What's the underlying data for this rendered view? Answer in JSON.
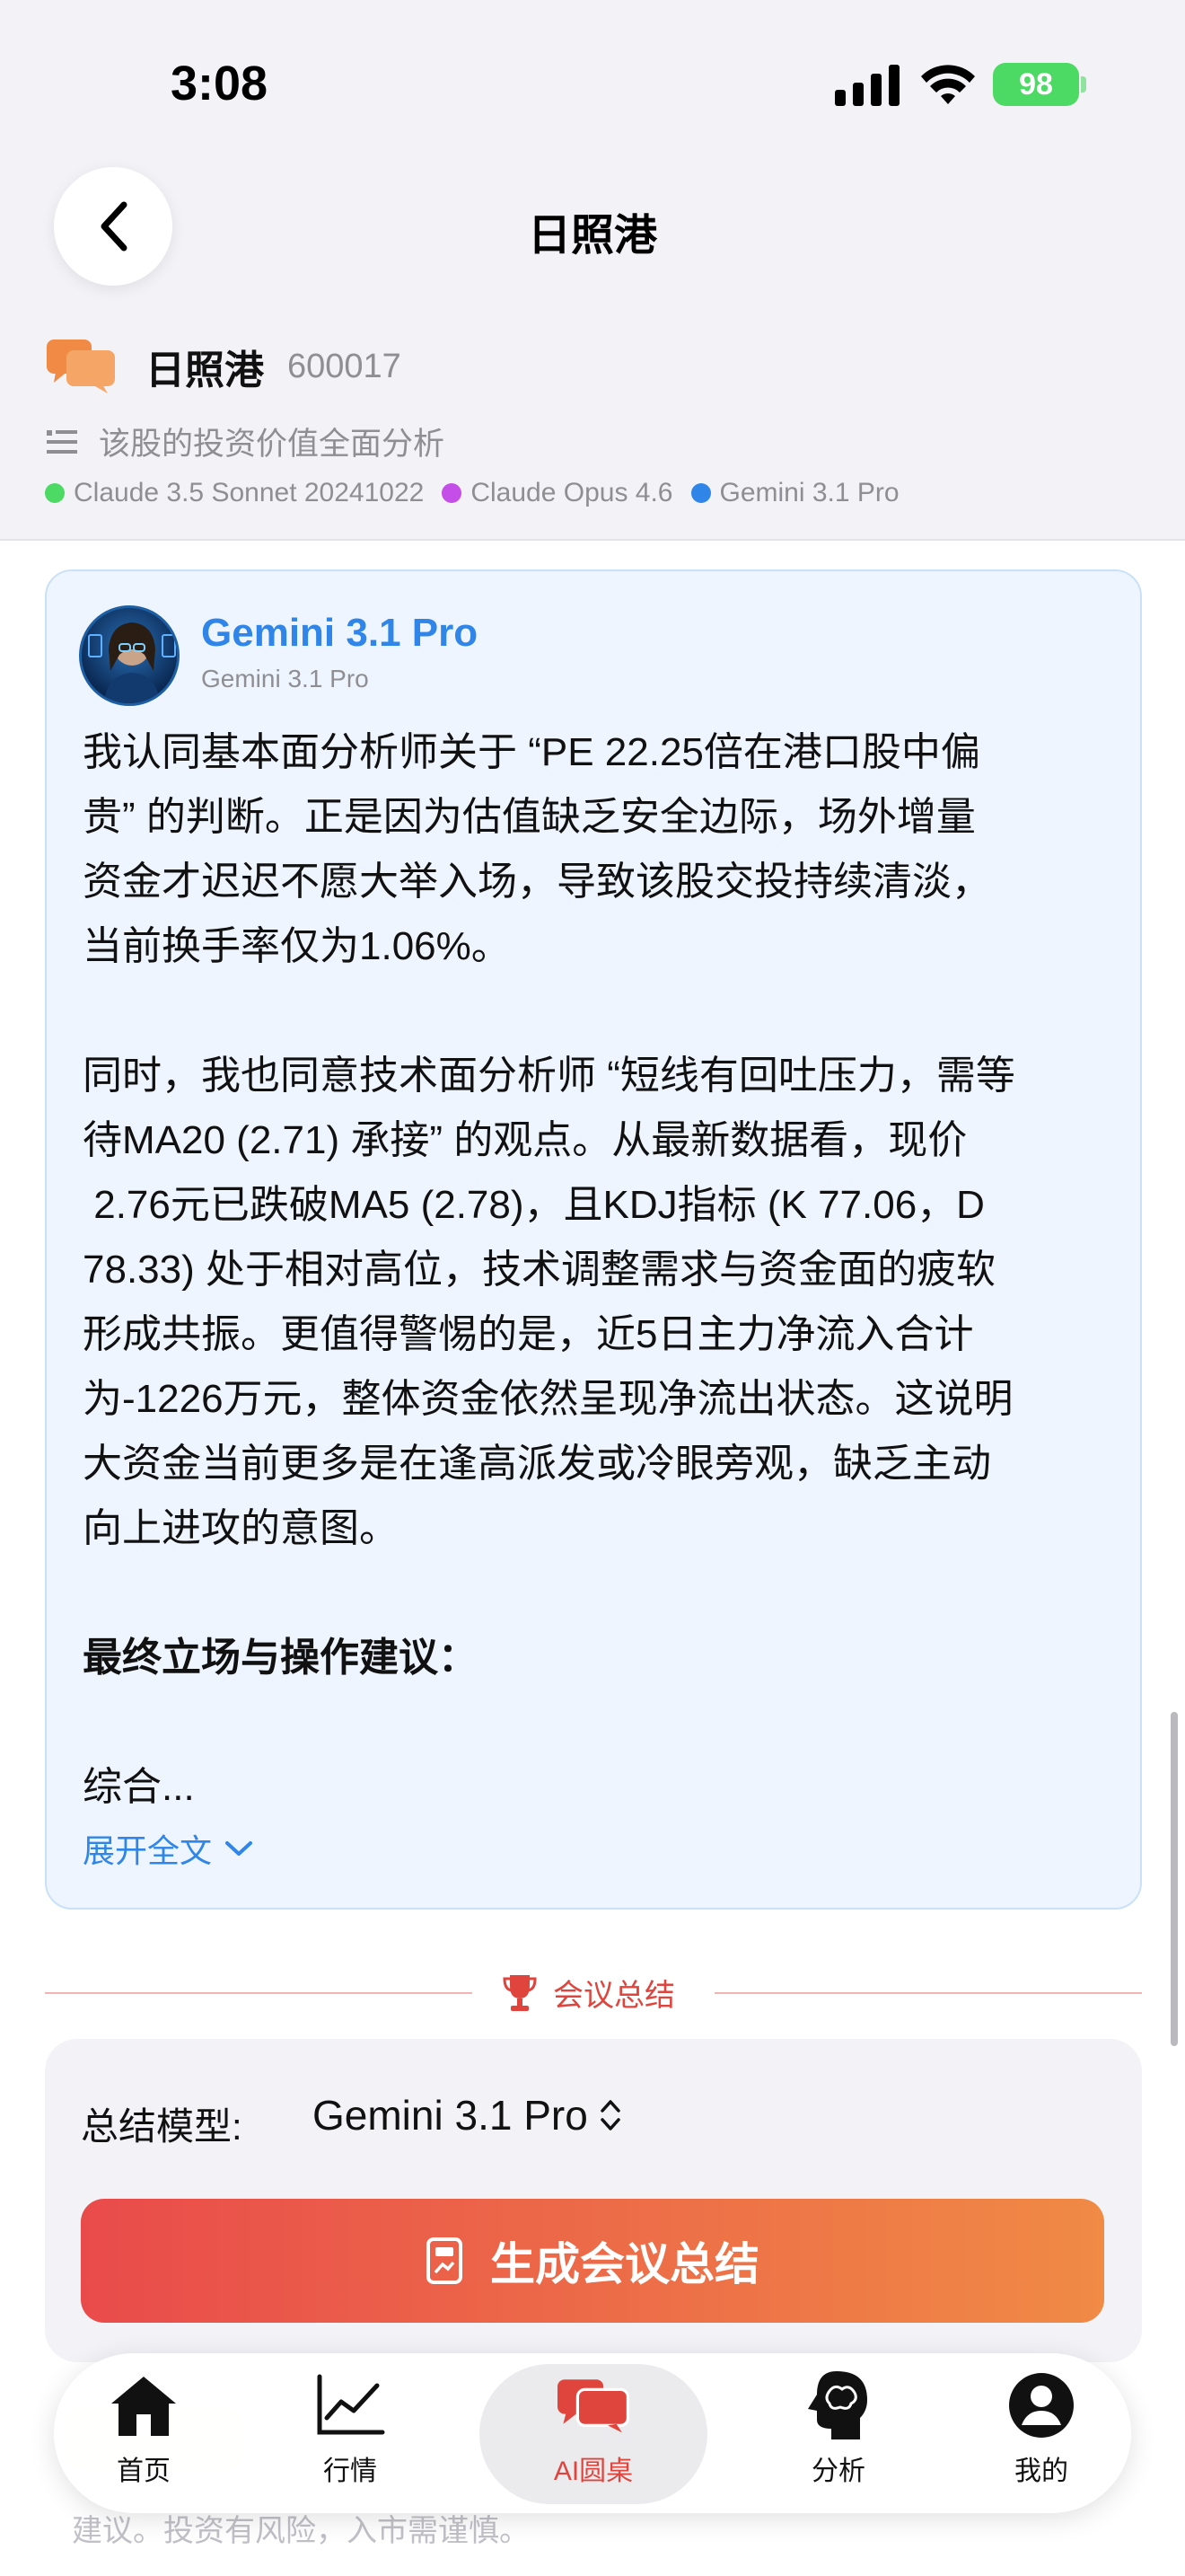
{
  "status_bar": {
    "time": "3:08",
    "battery": "98"
  },
  "nav": {
    "title": "日照港"
  },
  "stock": {
    "name": "日照港",
    "code": "600017",
    "topic": "该股的投资价值全面分析"
  },
  "models": [
    {
      "label": "Claude 3.5 Sonnet 20241022",
      "color": "#4cd964"
    },
    {
      "label": "Claude Opus 4.6",
      "color": "#c54de8"
    },
    {
      "label": "Gemini 3.1 Pro",
      "color": "#2f86e8"
    }
  ],
  "message": {
    "author": "Gemini 3.1 Pro",
    "author_sub": "Gemini 3.1 Pro",
    "para1_lines": [
      "我认同基本面分析师关于 “PE 22.25倍在港口股中偏",
      "贵” 的判断。正是因为估值缺乏安全边际，场外增量",
      "资金才迟迟不愿大举入场，导致该股交投持续清淡，",
      "当前换手率仅为1.06%。"
    ],
    "para2_lines": [
      "同时，我也同意技术面分析师 “短线有回吐压力，需等",
      "待MA20 (2.71) 承接” 的观点。从最新数据看，现价",
      " 2.76元已跌破MA5 (2.78)，且KDJ指标 (K 77.06，D",
      "78.33) 处于相对高位，技术调整需求与资金面的疲软",
      "形成共振。更值得警惕的是，近5日主力净流入合计",
      "为-1226万元，整体资金依然呈现净流出状态。这说明",
      "大资金当前更多是在逢高派发或冷眼旁观，缺乏主动",
      "向上进攻的意图。"
    ],
    "heading": "最终立场与操作建议：",
    "truncated": "综合...",
    "expand_label": "展开全文"
  },
  "divider": {
    "label": "会议总结"
  },
  "summary": {
    "model_label": "总结模型:",
    "model_value": "Gemini 3.1 Pro",
    "generate_label": "生成会议总结"
  },
  "faded_text": "建议。投资有风险，入市需谨慎。",
  "tabs": [
    {
      "label": "首页",
      "icon": "home-icon",
      "active": false
    },
    {
      "label": "行情",
      "icon": "chart-icon",
      "active": false
    },
    {
      "label": "AI圆桌",
      "icon": "chat-bubbles-icon",
      "active": true
    },
    {
      "label": "分析",
      "icon": "brain-head-icon",
      "active": false
    },
    {
      "label": "我的",
      "icon": "user-icon",
      "active": false
    }
  ],
  "colors": {
    "accent_red": "#e0453d",
    "accent_blue": "#2f86e8",
    "button_gradient_start": "#e94b4b",
    "button_gradient_end": "#f08a45"
  }
}
